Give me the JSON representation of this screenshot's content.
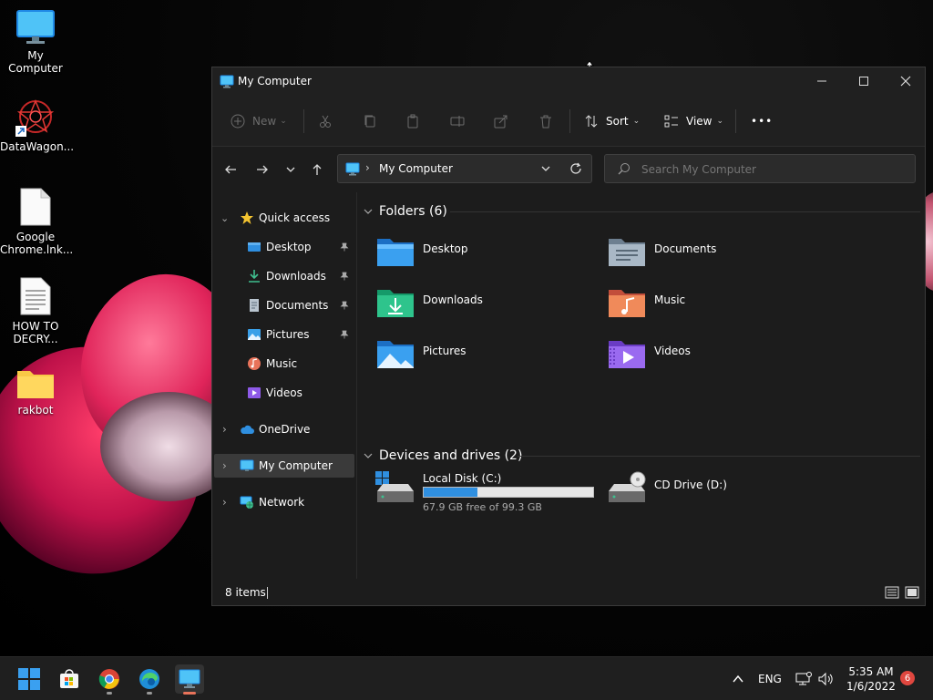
{
  "desktop": {
    "icons": [
      {
        "label": "My Computer",
        "icon": "monitor-icon"
      },
      {
        "label": "DataWagon...",
        "icon": "datawagon-shortcut-icon"
      },
      {
        "label": "Google Chrome.lnk...",
        "icon": "file-icon"
      },
      {
        "label": "HOW TO DECRY...",
        "icon": "text-file-icon"
      },
      {
        "label": "rakbot",
        "icon": "folder-icon"
      }
    ]
  },
  "window": {
    "title": "My Computer",
    "toolbar": {
      "new_label": "New",
      "sort_label": "Sort",
      "view_label": "View",
      "more_label": "•••"
    },
    "address": {
      "location": "My Computer"
    },
    "search": {
      "placeholder": "Search My Computer"
    },
    "sidebar": {
      "quick_access": "Quick access",
      "quick_items": [
        {
          "label": "Desktop",
          "icon": "desktop-icon",
          "pinned": true
        },
        {
          "label": "Downloads",
          "icon": "downloads-icon",
          "pinned": true
        },
        {
          "label": "Documents",
          "icon": "documents-icon",
          "pinned": true
        },
        {
          "label": "Pictures",
          "icon": "pictures-icon",
          "pinned": true
        },
        {
          "label": "Music",
          "icon": "music-icon",
          "pinned": false
        },
        {
          "label": "Videos",
          "icon": "videos-icon",
          "pinned": false
        }
      ],
      "onedrive": "OneDrive",
      "my_computer": "My Computer",
      "network": "Network"
    },
    "content": {
      "folders_header": "Folders (6)",
      "folders": [
        {
          "label": "Desktop",
          "icon": "desktop-folder-icon"
        },
        {
          "label": "Documents",
          "icon": "documents-folder-icon"
        },
        {
          "label": "Downloads",
          "icon": "downloads-folder-icon"
        },
        {
          "label": "Music",
          "icon": "music-folder-icon"
        },
        {
          "label": "Pictures",
          "icon": "pictures-folder-icon"
        },
        {
          "label": "Videos",
          "icon": "videos-folder-icon"
        }
      ],
      "drives_header": "Devices and drives (2)",
      "drives": [
        {
          "label": "Local Disk (C:)",
          "free_text": "67.9 GB free of 99.3 GB",
          "used_fraction": 0.316,
          "icon": "local-disk-icon"
        },
        {
          "label": "CD Drive (D:)",
          "icon": "cd-drive-icon"
        }
      ]
    },
    "status": {
      "items": "8 items"
    }
  },
  "taskbar": {
    "lang": "ENG",
    "time": "5:35 AM",
    "date": "1/6/2022",
    "notifications": "6"
  },
  "colors": {
    "accent": "#2f8fe0",
    "selection": "#3a3a3a",
    "badge": "#e0473f"
  }
}
